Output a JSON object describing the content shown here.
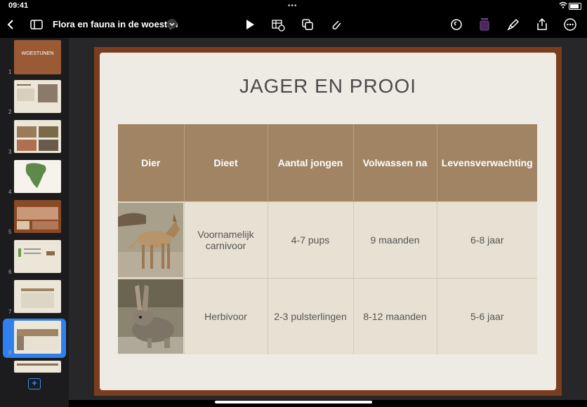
{
  "status": {
    "time": "09:41",
    "dots": "•••"
  },
  "toolbar": {
    "title": "Flora en fauna in de woestijn"
  },
  "slides": [
    {
      "num": "1",
      "label": "WOESTIJNEN"
    },
    {
      "num": "2"
    },
    {
      "num": "3"
    },
    {
      "num": "4"
    },
    {
      "num": "5"
    },
    {
      "num": "6"
    },
    {
      "num": "7"
    },
    {
      "num": "8"
    }
  ],
  "slide": {
    "title": "JAGER EN PROOI",
    "headers": [
      "Dier",
      "Dieet",
      "Aantal jongen",
      "Volwassen na",
      "Levensverwachting"
    ],
    "rows": [
      {
        "dieet": "Voornamelijk carnivoor",
        "jongen": "4-7 pups",
        "volwassen": "9 maanden",
        "leven": "6-8 jaar"
      },
      {
        "dieet": "Herbivoor",
        "jongen": "2-3 pulsterlingen",
        "volwassen": "8-12 maanden",
        "leven": "5-6 jaar"
      }
    ]
  },
  "colors": {
    "accent": "#2f80ed",
    "header_bg": "#a08464",
    "cell_bg": "#e6e1d2",
    "frame": "#7a3d1e"
  },
  "icons": [
    "back-icon",
    "sidebar-icon",
    "chevron-down-icon",
    "play-icon",
    "table-icon",
    "shapes-icon",
    "attachment-icon",
    "undo-icon",
    "format-icon",
    "brush-icon",
    "share-icon",
    "more-icon",
    "plus-icon"
  ]
}
